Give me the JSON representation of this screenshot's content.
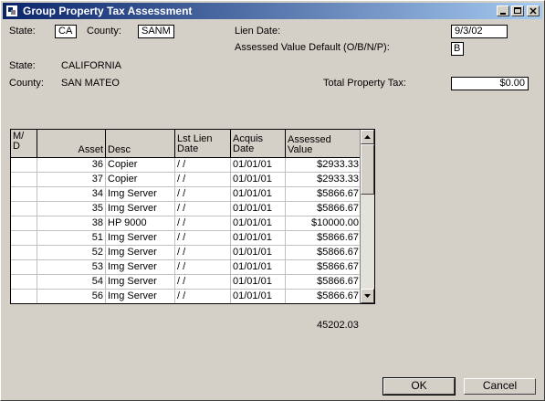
{
  "window": {
    "title": "Group Property Tax Assessment"
  },
  "form": {
    "state_label": "State:",
    "state_value": "CA",
    "county_label": "County:",
    "county_value": "SANM",
    "lien_date_label": "Lien Date:",
    "lien_date_value": "9/3/02",
    "assessed_default_label": "Assessed Value Default (O/B/N/P):",
    "assessed_default_value": "B",
    "state_full_label": "State:",
    "state_full_value": "CALIFORNIA",
    "county_full_label": "County:",
    "county_full_value": "SAN MATEO",
    "total_tax_label": "Total Property Tax:",
    "total_tax_value": "$0.00"
  },
  "grid": {
    "columns": [
      {
        "line1": "M/",
        "line2": "D"
      },
      {
        "line1": "",
        "line2": "Asset"
      },
      {
        "line1": "",
        "line2": "Desc"
      },
      {
        "line1": "Lst Lien",
        "line2": "Date"
      },
      {
        "line1": "Acquis",
        "line2": "Date"
      },
      {
        "line1": "",
        "line2": "Assessed Value"
      }
    ],
    "rows": [
      {
        "md": "",
        "asset": "36",
        "desc": "Copier",
        "lien": " /  /",
        "acq": "01/01/01",
        "value": "$2933.33"
      },
      {
        "md": "",
        "asset": "37",
        "desc": "Copier",
        "lien": " /  /",
        "acq": "01/01/01",
        "value": "$2933.33"
      },
      {
        "md": "",
        "asset": "34",
        "desc": "Img Server",
        "lien": " /  /",
        "acq": "01/01/01",
        "value": "$5866.67"
      },
      {
        "md": "",
        "asset": "35",
        "desc": "Img Server",
        "lien": " /  /",
        "acq": "01/01/01",
        "value": "$5866.67"
      },
      {
        "md": "",
        "asset": "38",
        "desc": "HP 9000",
        "lien": " /  /",
        "acq": "01/01/01",
        "value": "$10000.00"
      },
      {
        "md": "",
        "asset": "51",
        "desc": "Img Server",
        "lien": " /  /",
        "acq": "01/01/01",
        "value": "$5866.67"
      },
      {
        "md": "",
        "asset": "52",
        "desc": "Img Server",
        "lien": " /  /",
        "acq": "01/01/01",
        "value": "$5866.67"
      },
      {
        "md": "",
        "asset": "53",
        "desc": "Img Server",
        "lien": " /  /",
        "acq": "01/01/01",
        "value": "$5866.67"
      },
      {
        "md": "",
        "asset": "54",
        "desc": "Img Server",
        "lien": " /  /",
        "acq": "01/01/01",
        "value": "$5866.67"
      },
      {
        "md": "",
        "asset": "56",
        "desc": "Img Server",
        "lien": " /  /",
        "acq": "01/01/01",
        "value": "$5866.67"
      }
    ],
    "total": "45202.03"
  },
  "buttons": {
    "ok": "OK",
    "cancel": "Cancel"
  }
}
